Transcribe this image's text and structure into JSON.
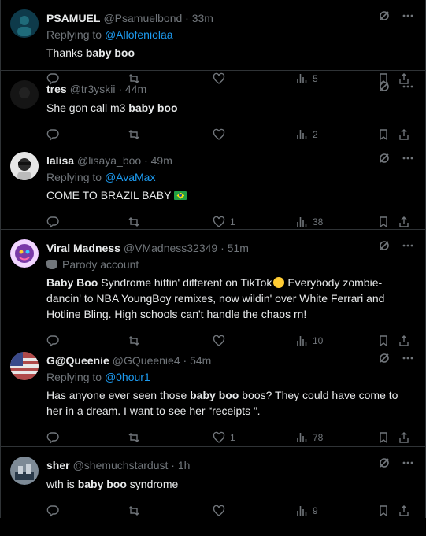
{
  "tweets": [
    {
      "name": "PSAMUEL",
      "handle": "@Psamuelbond",
      "time": "· 33m",
      "replying_label": "Replying to",
      "replying_to": "@Allofeniolaa",
      "body_pre": "Thanks ",
      "body_bold": "baby boo",
      "body_post": "",
      "likes": "",
      "views": "5",
      "avatar_color": "#0e3a4a"
    },
    {
      "name": "tres",
      "handle": "@tr3yskii",
      "time": "· 44m",
      "body_pre": "She gon call m3 ",
      "body_bold": "baby boo",
      "body_post": "",
      "likes": "",
      "views": "2",
      "avatar_color": "#111111"
    },
    {
      "name": "lalisa",
      "handle": "@lisaya_boo",
      "time": "· 49m",
      "replying_label": "Replying to",
      "replying_to": "@AvaMax",
      "body_pre": "COME TO BRAZIL BABY",
      "body_bold": "",
      "body_post": "",
      "likes": "1",
      "views": "38",
      "avatar_color": "#d9d9d9"
    },
    {
      "name": "Viral Madness",
      "handle": "@VMadness32349",
      "time": "· 51m",
      "parody_label": "Parody account",
      "body_bold": "Baby Boo",
      "body_post": " Syndrome hittin' different on TikTok",
      "body_post2": " Everybody zombie-dancin' to NBA YoungBoy remixes, now wildin' over White Ferrari and Hotline Bling. High schools can't handle the chaos rn!",
      "likes": "",
      "views": "10",
      "avatar_color": "#7a3aa8"
    },
    {
      "name": "G@Queenie",
      "handle": "@GQueenie4",
      "time": "· 54m",
      "replying_label": "Replying to",
      "replying_to": "@0hour1",
      "body_pre": "Has anyone ever seen those ",
      "body_bold": "baby boo",
      "body_post": " boos? They could have come to her in a dream. I want to see her “receipts ”.",
      "likes": "1",
      "views": "78",
      "avatar_color": "#8c6a5a"
    },
    {
      "name": "sher",
      "handle": "@shemuchstardust",
      "time": "· 1h",
      "body_pre": "wth is ",
      "body_bold": "baby boo",
      "body_post": " syndrome",
      "likes": "",
      "views": "9",
      "avatar_color": "#3a4a5a"
    }
  ],
  "icons": {
    "grok": "grok-icon",
    "more": "more-icon",
    "reply": "reply-icon",
    "repost": "repost-icon",
    "like": "like-icon",
    "views": "views-icon",
    "bookmark": "bookmark-icon",
    "share": "share-icon"
  },
  "colors": {
    "link": "#1d9bf0",
    "muted": "#71767b",
    "text": "#e7e9ea",
    "border": "#2f3336"
  }
}
